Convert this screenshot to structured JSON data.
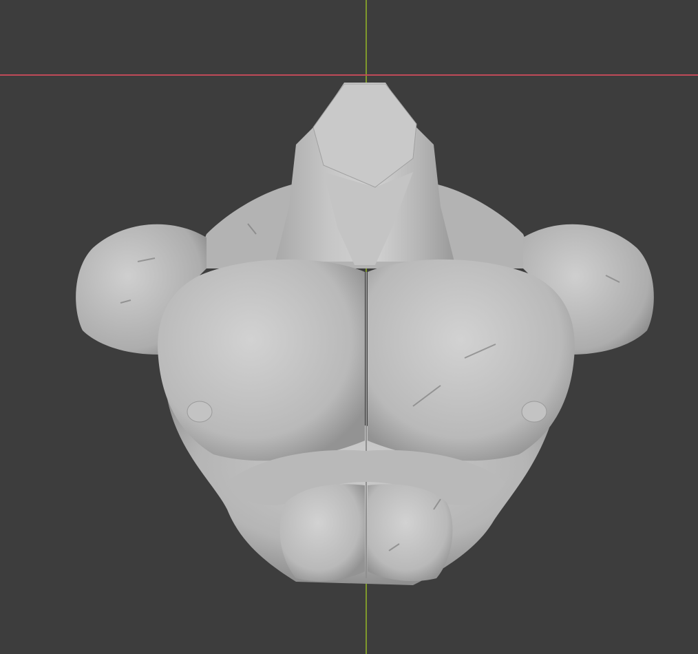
{
  "viewport": {
    "background_color": "#3d3d3d",
    "x_axis_color": "#c14a58",
    "y_axis_color": "#7f9a2c",
    "mesh_color": "#bdbdbd",
    "mesh_shadow_color": "#8e8e8e",
    "mesh_highlight_color": "#d6d6d6"
  },
  "object": {
    "icon": "sculpt-torso-mesh"
  }
}
